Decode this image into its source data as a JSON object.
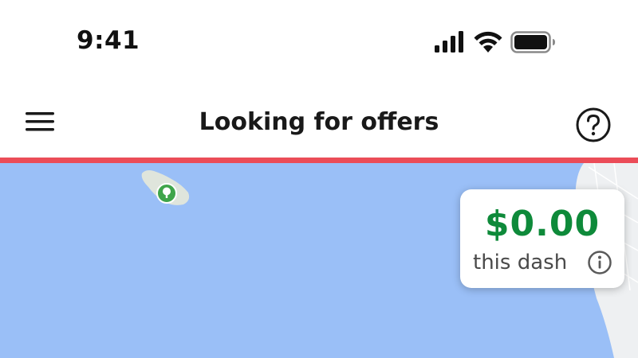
{
  "status_bar": {
    "time": "9:41",
    "icons": [
      "cellular-signal-icon",
      "wifi-icon",
      "battery-icon"
    ]
  },
  "header": {
    "title": "Looking for offers",
    "menu_icon": "hamburger-menu-icon",
    "help_icon": "question-mark-circle-icon"
  },
  "status_color": "#eb4c58",
  "map": {
    "water_color": "#9abff7",
    "marker_icon": "park-tree-icon",
    "marker_color": "#3fa54a"
  },
  "earnings": {
    "amount": "$0.00",
    "label": "this dash",
    "info_icon": "info-circle-icon",
    "amount_color": "#0e8a3a"
  }
}
